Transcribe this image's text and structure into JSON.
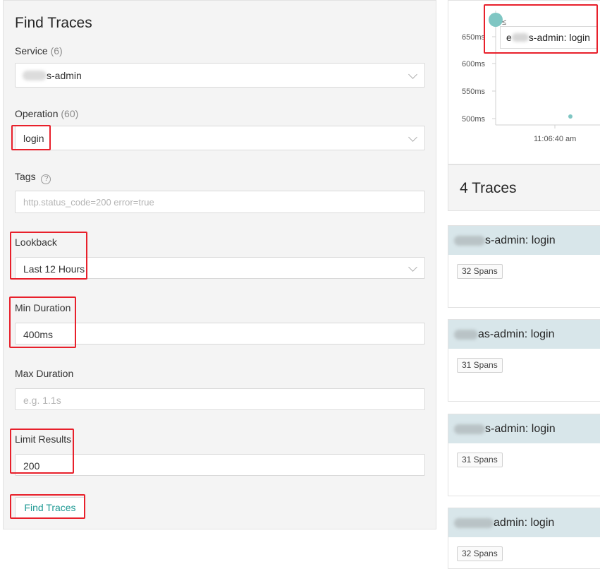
{
  "search": {
    "title": "Find Traces",
    "service": {
      "label": "Service",
      "count": "(6)",
      "value": "s-admin"
    },
    "operation": {
      "label": "Operation",
      "count": "(60)",
      "value": "login"
    },
    "tags": {
      "label": "Tags",
      "help": "?",
      "placeholder": "http.status_code=200 error=true"
    },
    "lookback": {
      "label": "Lookback",
      "value": "Last 12 Hours"
    },
    "min_duration": {
      "label": "Min Duration",
      "value": "400ms"
    },
    "max_duration": {
      "label": "Max Duration",
      "placeholder": "e.g. 1.1s"
    },
    "limit": {
      "label": "Limit Results",
      "value": "200"
    },
    "find_button": "Find Traces"
  },
  "chart": {
    "tooltip": "s-admin: login",
    "tooltip_prefix": "e",
    "legend_glyph": "≤",
    "y_ticks": [
      "650ms",
      "600ms",
      "550ms",
      "500ms"
    ],
    "x_tick": "11:06:40 am",
    "point_color": "#7fc6c3"
  },
  "results": {
    "title": "4 Traces",
    "traces": [
      {
        "name": "s-admin: login",
        "spans": "32 Spans"
      },
      {
        "name": "as-admin: login",
        "spans": "31 Spans"
      },
      {
        "name": "s-admin: login",
        "spans": "31 Spans"
      },
      {
        "name": "admin: login",
        "spans": "32 Spans"
      }
    ]
  }
}
